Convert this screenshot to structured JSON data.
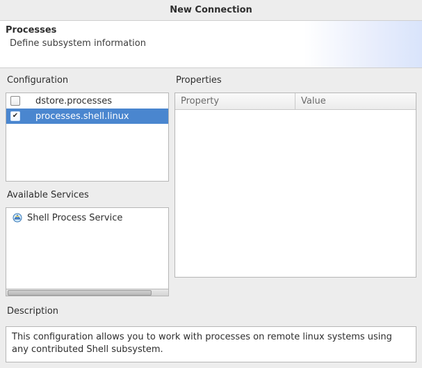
{
  "window": {
    "title": "New Connection"
  },
  "banner": {
    "title": "Processes",
    "subtitle": "Define subsystem information"
  },
  "labels": {
    "configuration": "Configuration",
    "properties": "Properties",
    "available_services": "Available Services",
    "description": "Description"
  },
  "configuration": {
    "items": [
      {
        "label": "dstore.processes",
        "checked": false,
        "selected": false
      },
      {
        "label": "processes.shell.linux",
        "checked": true,
        "selected": true
      }
    ]
  },
  "properties": {
    "columns": {
      "property": "Property",
      "value": "Value"
    },
    "rows": []
  },
  "available_services": {
    "items": [
      {
        "label": "Shell Process Service",
        "icon": "service-icon"
      }
    ]
  },
  "description": {
    "text": "This configuration allows you to work with processes on remote linux systems using any contributed Shell subsystem."
  }
}
